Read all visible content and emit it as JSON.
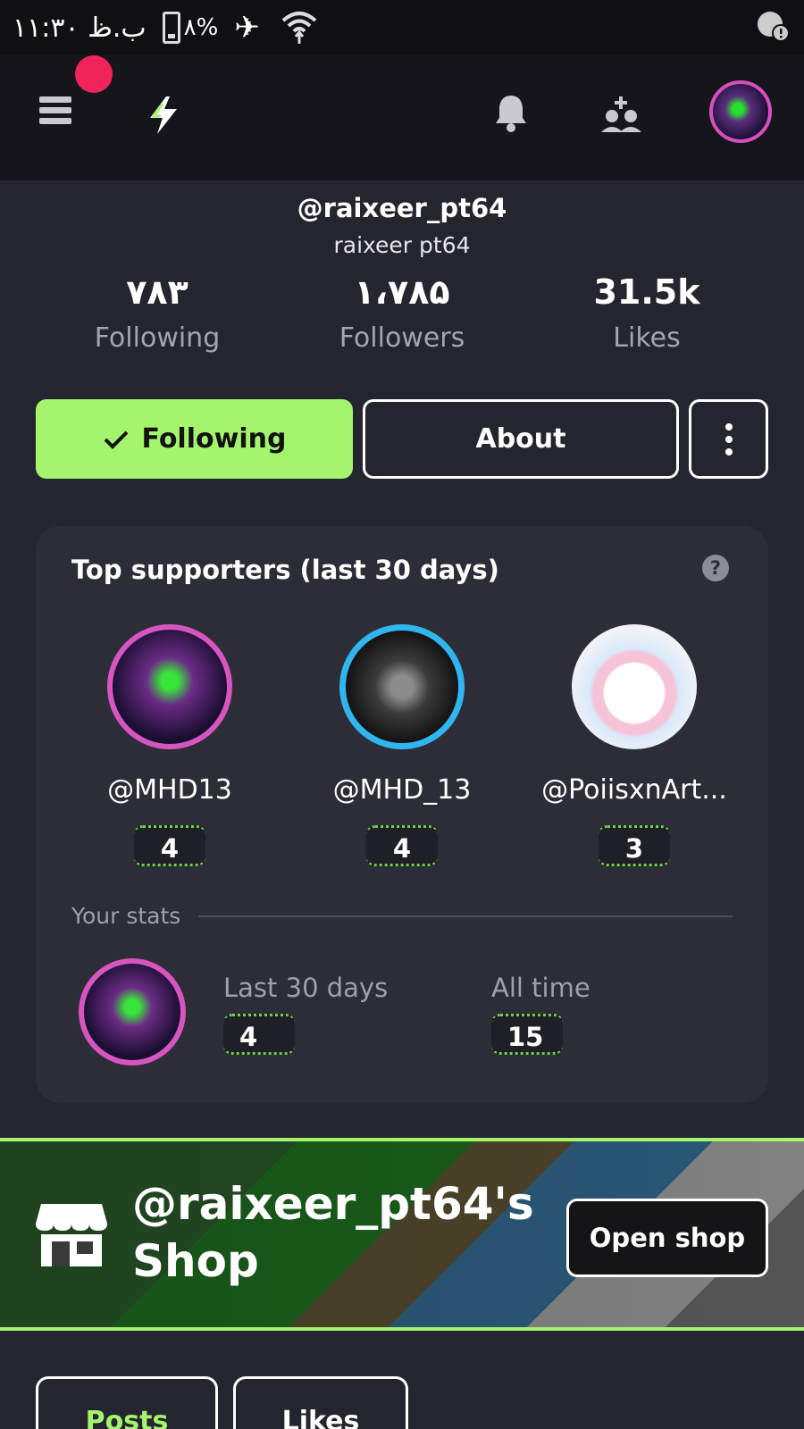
{
  "status_bar": {
    "time": "ب.ظ ۱۱:۳۰",
    "battery": "۸%",
    "icons": [
      "battery-charging-icon",
      "airplane-icon",
      "wifi-icon",
      "alert-icon"
    ]
  },
  "app_bar": {
    "icons": [
      "menu-icon",
      "logo-bolt-icon",
      "bell-icon",
      "add-friends-icon",
      "avatar"
    ]
  },
  "profile": {
    "handle": "@raixeer_pt64",
    "display_name": "raixeer pt64",
    "stats": [
      {
        "value": "۷۸۳",
        "label": "Following"
      },
      {
        "value": "۱،۷۸۵",
        "label": "Followers"
      },
      {
        "value": "31.5k",
        "label": "Likes"
      }
    ]
  },
  "actions": {
    "following_label": "Following",
    "about_label": "About"
  },
  "supporters": {
    "title": "Top supporters (last 30 days)",
    "items": [
      {
        "name": "@MHD13",
        "count": "4"
      },
      {
        "name": "@MHD_13",
        "count": "4"
      },
      {
        "name": "@PoiisxnArt...",
        "count": "3"
      }
    ],
    "your_stats_label": "Your stats",
    "your_stats": [
      {
        "label": "Last 30 days",
        "count": "4"
      },
      {
        "label": "All time",
        "count": "15"
      }
    ]
  },
  "shop": {
    "title": "@raixeer_pt64's Shop",
    "button_label": "Open shop"
  },
  "tabs": [
    {
      "label": "Posts",
      "active": true
    },
    {
      "label": "Likes",
      "active": false
    }
  ],
  "colors": {
    "accent": "#a4f46e",
    "background": "#25252f",
    "card": "#2d2d38",
    "notification": "#f0245a"
  }
}
